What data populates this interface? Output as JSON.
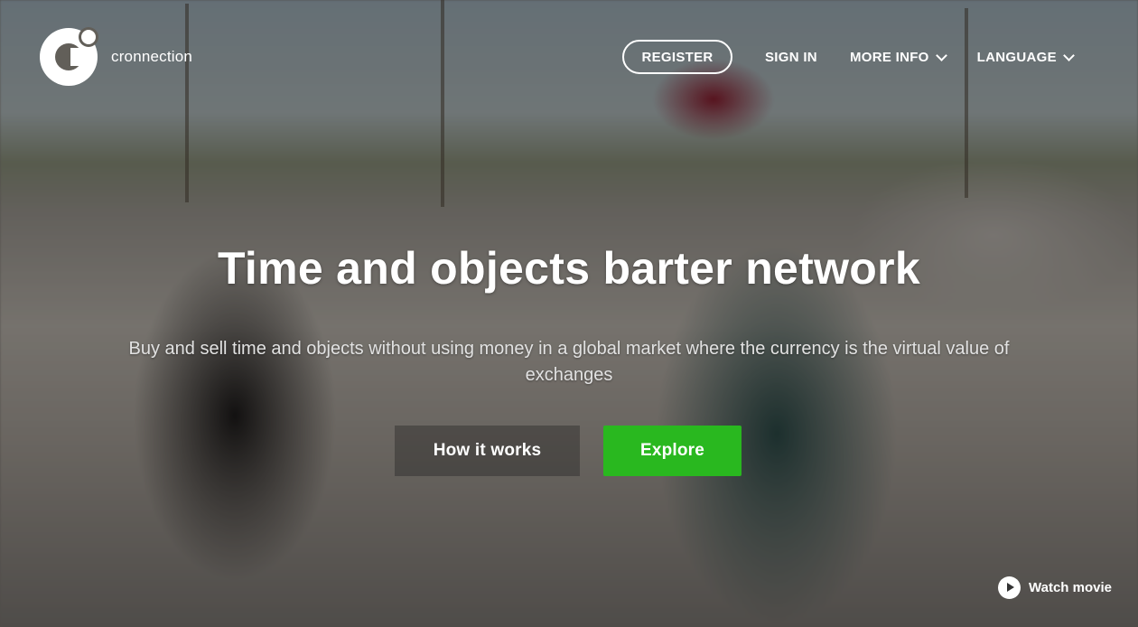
{
  "brand": {
    "name": "cronnection"
  },
  "nav": {
    "register": "REGISTER",
    "sign_in": "SIGN IN",
    "more_info": "MORE INFO",
    "language": "LANGUAGE"
  },
  "hero": {
    "title": "Time and objects barter network",
    "subtitle": "Buy and sell time and objects without using money in a global market where the currency is the virtual value of exchanges",
    "how_it_works": "How it works",
    "explore": "Explore",
    "watch_movie": "Watch movie"
  },
  "colors": {
    "accent_green": "#29b81f",
    "text": "#ffffff"
  },
  "icons": {
    "logo": "cronnection-logo-icon",
    "dropdown": "chevron-down-icon",
    "play": "play-icon"
  }
}
